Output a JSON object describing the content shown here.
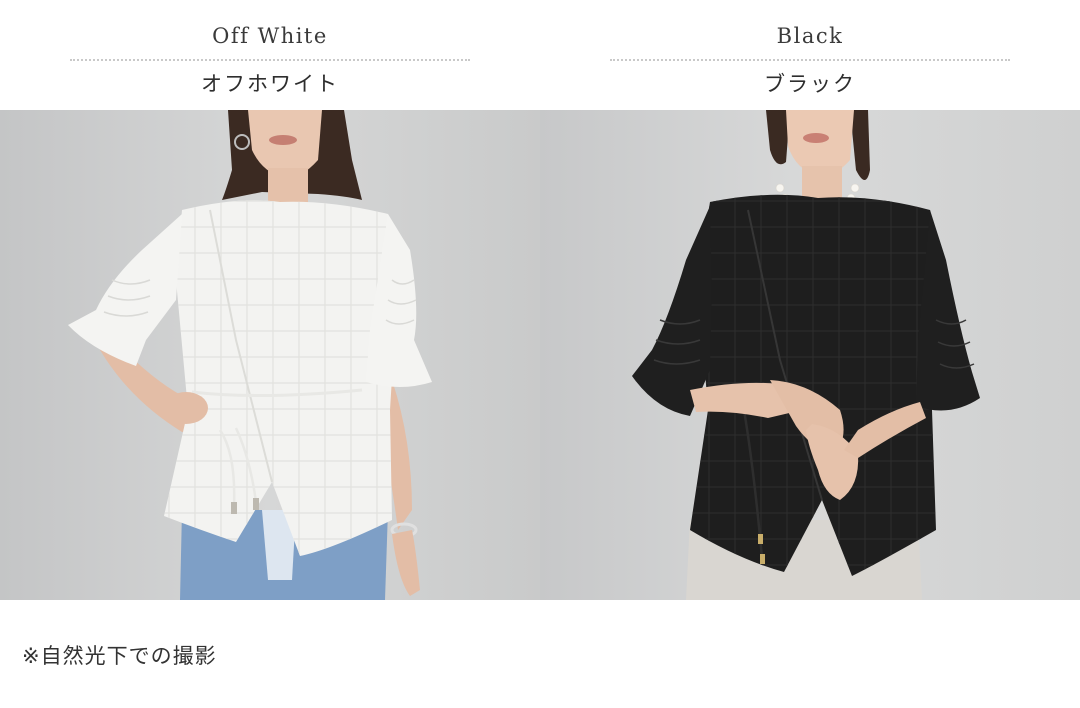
{
  "columns": [
    {
      "name_en": "Off White",
      "name_jp": "オフホワイト"
    },
    {
      "name_en": "Black",
      "name_jp": "ブラック"
    }
  ],
  "note": "※自然光下での撮影",
  "colors": {
    "background": "#ffffff",
    "divider": "#c9c9c9",
    "photo_backdrop": "#d0d1d1",
    "offwhite_garment": "#f3f3f1",
    "black_garment": "#1e1e1e",
    "denim": "#7e9fc6",
    "trousers": "#d9d6d1"
  }
}
